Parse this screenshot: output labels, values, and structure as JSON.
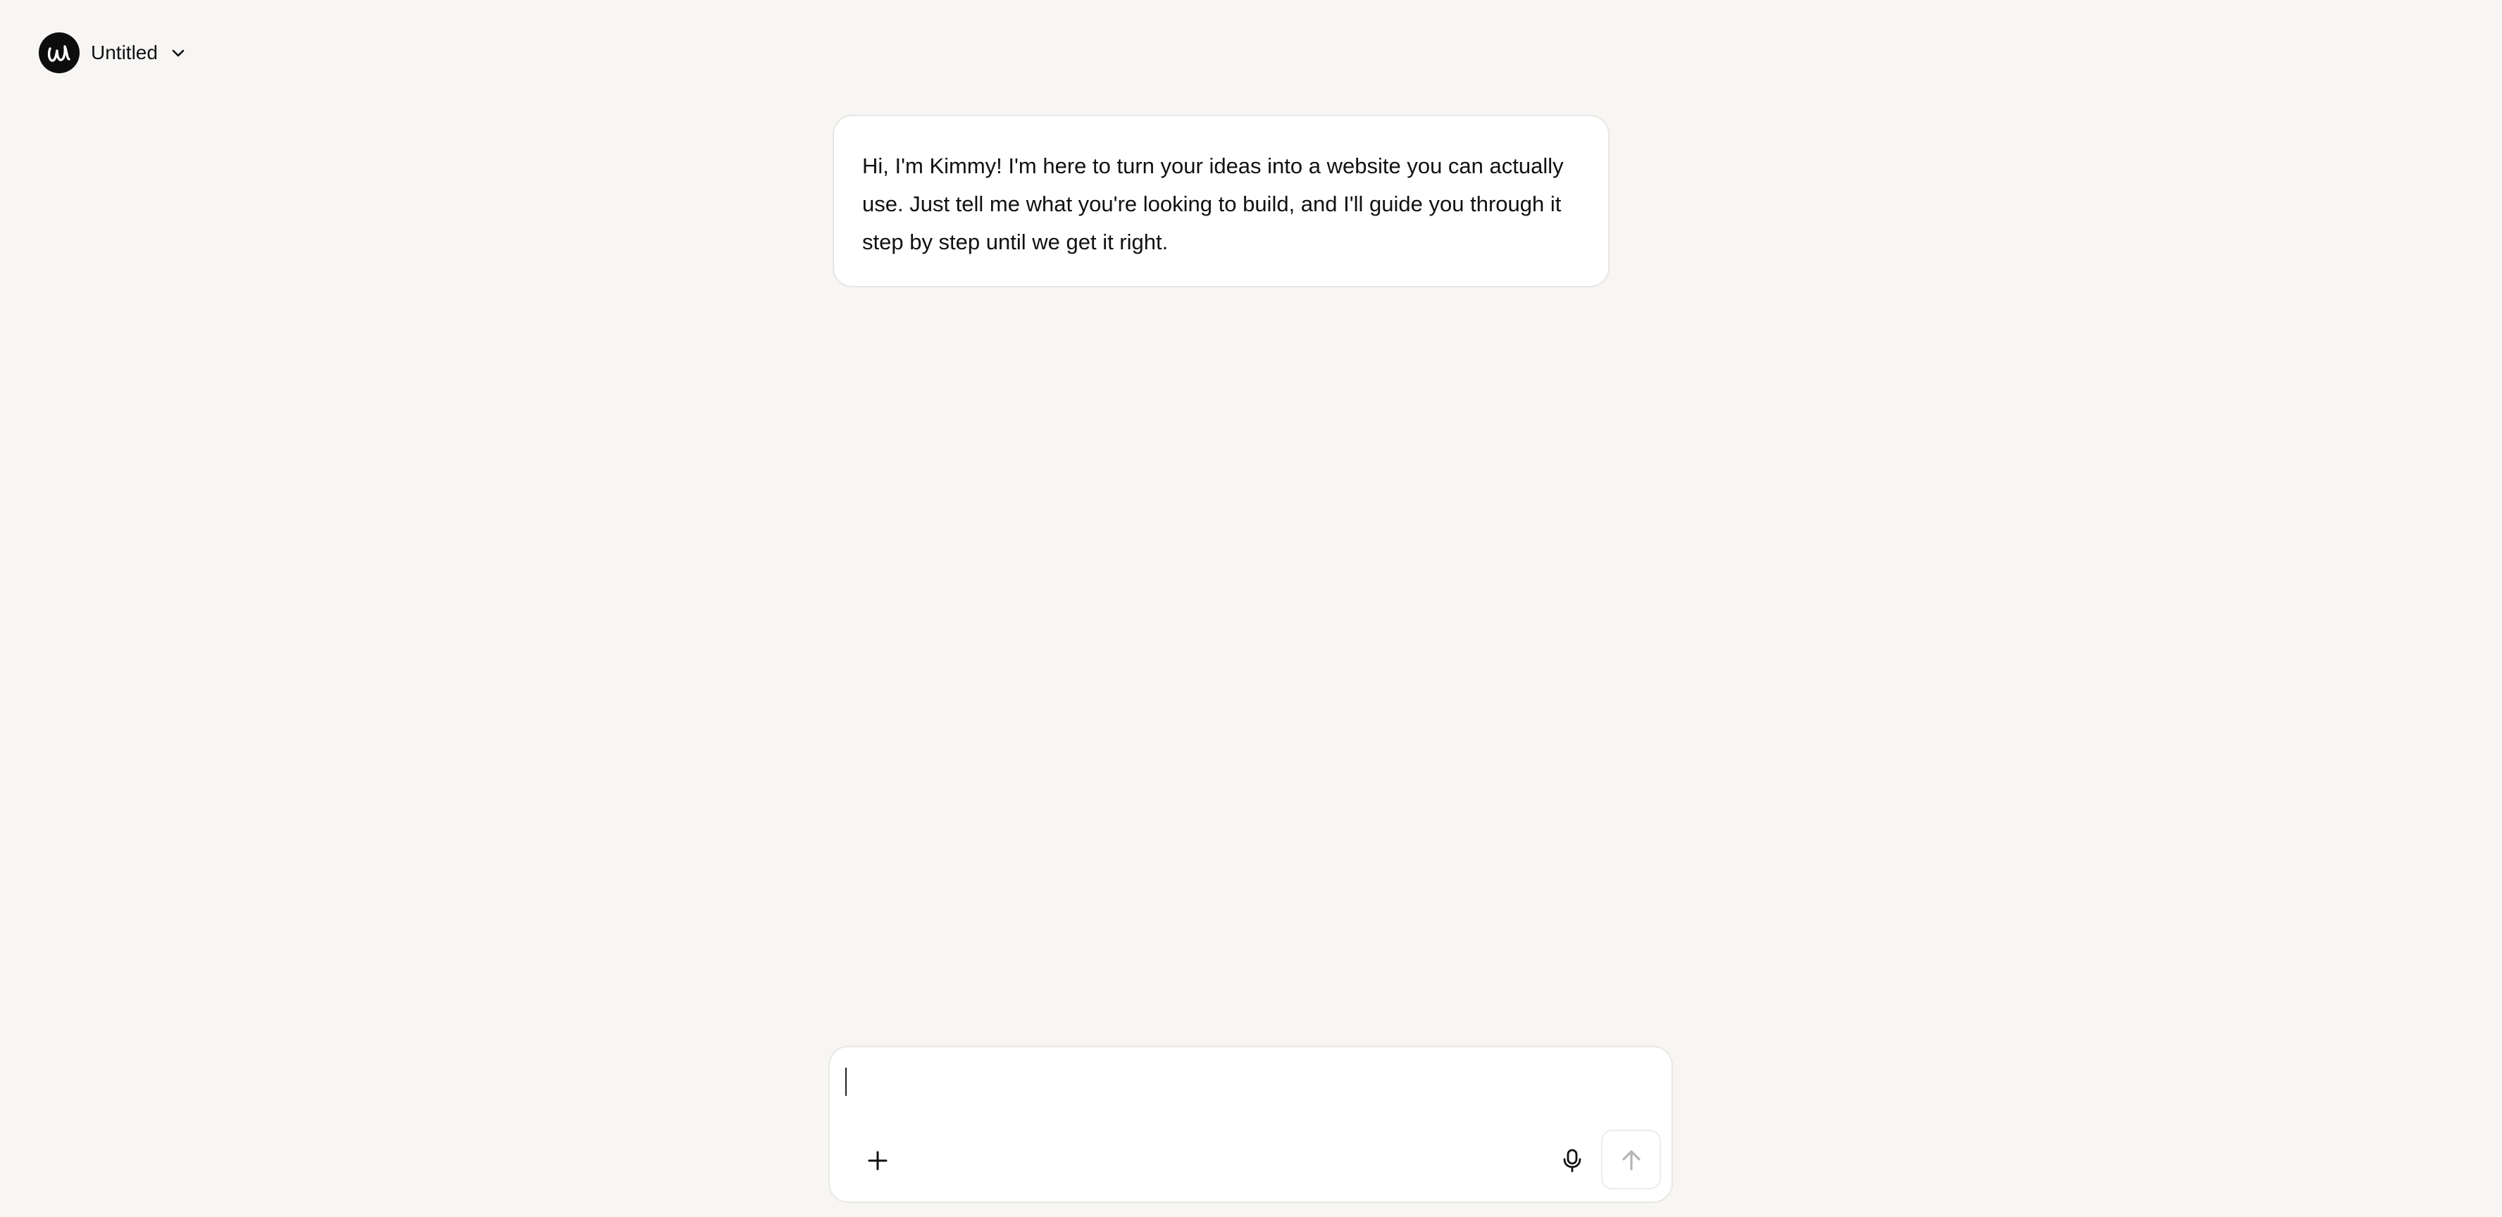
{
  "header": {
    "logo_icon": "writing-w-logo",
    "project_title": "Untitled",
    "dropdown_icon": "chevron-down-icon"
  },
  "chat": {
    "messages": [
      {
        "role": "assistant",
        "text": "Hi, I'm Kimmy! I'm here to turn your ideas into a website you can actually use. Just tell me what you're looking to build, and I'll guide you through it step by step until we get it right."
      }
    ]
  },
  "composer": {
    "value": "",
    "placeholder": "",
    "attach_icon": "plus-icon",
    "mic_icon": "microphone-icon",
    "send_icon": "arrow-up-icon"
  },
  "colors": {
    "background": "#f7f6f4",
    "surface": "#ffffff",
    "border": "#e8e7e4",
    "text": "#111111",
    "send_disabled": "#b5b5b5"
  }
}
